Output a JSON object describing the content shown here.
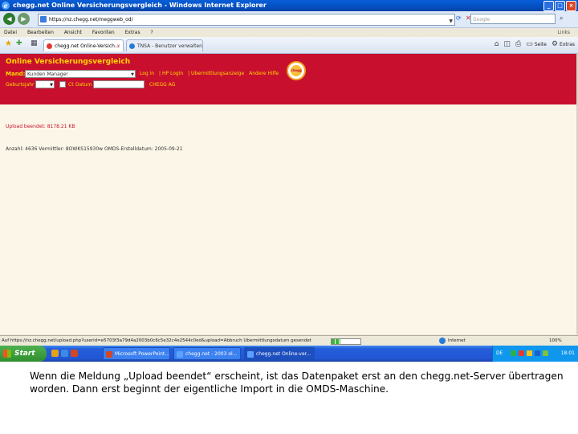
{
  "window": {
    "title": "chegg.net Online Versicherungsvergleich - Windows Internet Explorer",
    "min": "_",
    "max": "□",
    "close": "×"
  },
  "address": {
    "url": "https://nz.chegg.net/meggweb_od/",
    "search_placeholder": "Google"
  },
  "menu": {
    "items": [
      "Datei",
      "Bearbeiten",
      "Ansicht",
      "Favoriten",
      "Extras",
      "?"
    ],
    "links": "Links"
  },
  "tabs": [
    {
      "label": "chegg.net Online-Versich..."
    },
    {
      "label": "TNSA - Benutzer verwalten"
    }
  ],
  "tools": {
    "page": "Seite",
    "extras": "Extras"
  },
  "app": {
    "title": "Online Versicherungsvergleich",
    "mandant_label": "Mand:",
    "mandant_value": "Kunden Manager",
    "links": [
      "Log in",
      "| HP Login",
      "| Ubermittlungsanzeige",
      "Andere Hilfe"
    ],
    "geburtsjahr_label": "Geburtsjahr",
    "check_label": "Ct",
    "date_label": "Datum",
    "company": "CHEGG AG",
    "logo_text": "chegg"
  },
  "content": {
    "upload_msg": "Upload beendet: 8178.21 KB",
    "info_line": "Anzahl: 4636   Vermittler: 8OWKS15930w   OMDS-Erstelldatum: 2005-09-21"
  },
  "status": {
    "url": "Auf https://nz.chegg.net/upload.php?userid=e5703f3a79d4a2003b0c6c5e32c4e2544c0ed&upload=Abbruch  Ubermittlungsdatum gesendet",
    "zone": "Internet",
    "zoom": "100%"
  },
  "taskbar": {
    "start": "Start",
    "tasks": [
      "Microsoft PowerPoint...",
      "chegg.net - 2003 ol...",
      "chegg.net Online-ver..."
    ],
    "lang": "DE",
    "clock": "18:01"
  },
  "caption": {
    "text": "Wenn die Meldung „Upload beendet“ erscheint, ist das Datenpaket erst an den chegg.net-Server übertragen worden. Dann erst beginnt der eigentliche Import in die OMDS-Maschine."
  },
  "colors": {
    "header_red": "#c8102e",
    "header_text": "#ffd800",
    "page_bg": "#fbf6e8"
  }
}
